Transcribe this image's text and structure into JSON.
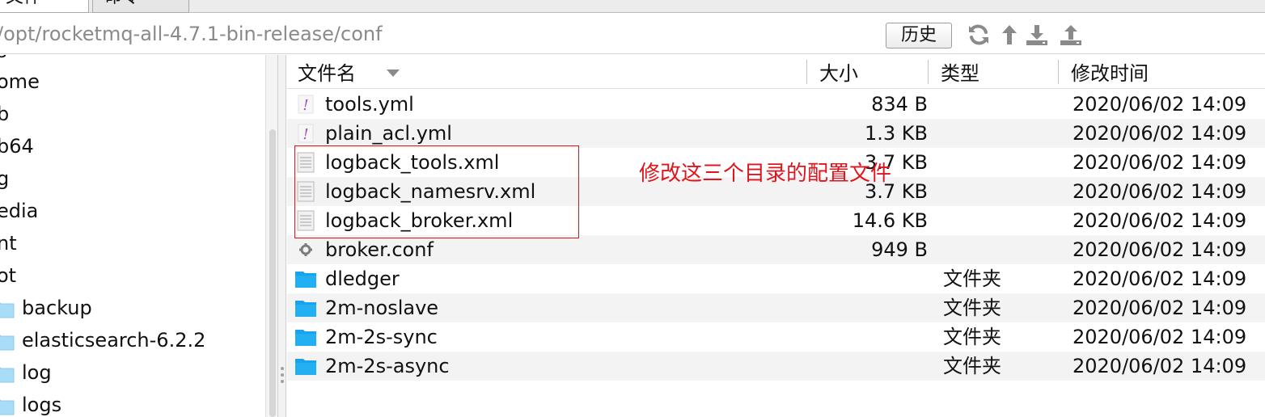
{
  "tabs": [
    {
      "label": "文件",
      "active": true
    },
    {
      "label": "命令",
      "active": false
    }
  ],
  "path": {
    "value": "/opt/rocketmq-all-4.7.1-bin-release/conf"
  },
  "toolbar": {
    "history_label": "历史",
    "icons": [
      "refresh-icon",
      "go-up-icon",
      "download-icon",
      "upload-icon"
    ]
  },
  "tree": {
    "items": [
      {
        "label": "s",
        "folder": false
      },
      {
        "label": "ome",
        "folder": false
      },
      {
        "label": "b",
        "folder": false
      },
      {
        "label": "b64",
        "folder": false
      },
      {
        "label": "g",
        "folder": false
      },
      {
        "label": "edia",
        "folder": false
      },
      {
        "label": "nt",
        "folder": false
      },
      {
        "label": "ot",
        "folder": false
      },
      {
        "label": "backup",
        "folder": true
      },
      {
        "label": "elasticsearch-6.2.2",
        "folder": true
      },
      {
        "label": "log",
        "folder": true
      },
      {
        "label": "logs",
        "folder": true
      }
    ]
  },
  "table": {
    "columns": {
      "name": "文件名",
      "size": "大小",
      "type": "类型",
      "modified": "修改时间"
    },
    "rows": [
      {
        "icon": "yml",
        "name": "tools.yml",
        "size": "834 B",
        "type": "",
        "modified": "2020/06/02 14:09"
      },
      {
        "icon": "yml",
        "name": "plain_acl.yml",
        "size": "1.3 KB",
        "type": "",
        "modified": "2020/06/02 14:09"
      },
      {
        "icon": "doc",
        "name": "logback_tools.xml",
        "size": "3.7 KB",
        "type": "",
        "modified": "2020/06/02 14:09"
      },
      {
        "icon": "doc",
        "name": "logback_namesrv.xml",
        "size": "3.7 KB",
        "type": "",
        "modified": "2020/06/02 14:09"
      },
      {
        "icon": "doc",
        "name": "logback_broker.xml",
        "size": "14.6 KB",
        "type": "",
        "modified": "2020/06/02 14:09"
      },
      {
        "icon": "gear",
        "name": "broker.conf",
        "size": "949 B",
        "type": "",
        "modified": "2020/06/02 14:09"
      },
      {
        "icon": "folder",
        "name": "dledger",
        "size": "",
        "type": "文件夹",
        "modified": "2020/06/02 14:09"
      },
      {
        "icon": "folder",
        "name": "2m-noslave",
        "size": "",
        "type": "文件夹",
        "modified": "2020/06/02 14:09"
      },
      {
        "icon": "folder",
        "name": "2m-2s-sync",
        "size": "",
        "type": "文件夹",
        "modified": "2020/06/02 14:09"
      },
      {
        "icon": "folder",
        "name": "2m-2s-async",
        "size": "",
        "type": "文件夹",
        "modified": "2020/06/02 14:09"
      }
    ]
  },
  "annotation": {
    "text": "修改这三个目录的配置文件",
    "color": "#e0141c"
  },
  "colors": {
    "folder": "#1aa3ec",
    "annotation": "#e0141c",
    "path_text": "#8a8a8a"
  }
}
